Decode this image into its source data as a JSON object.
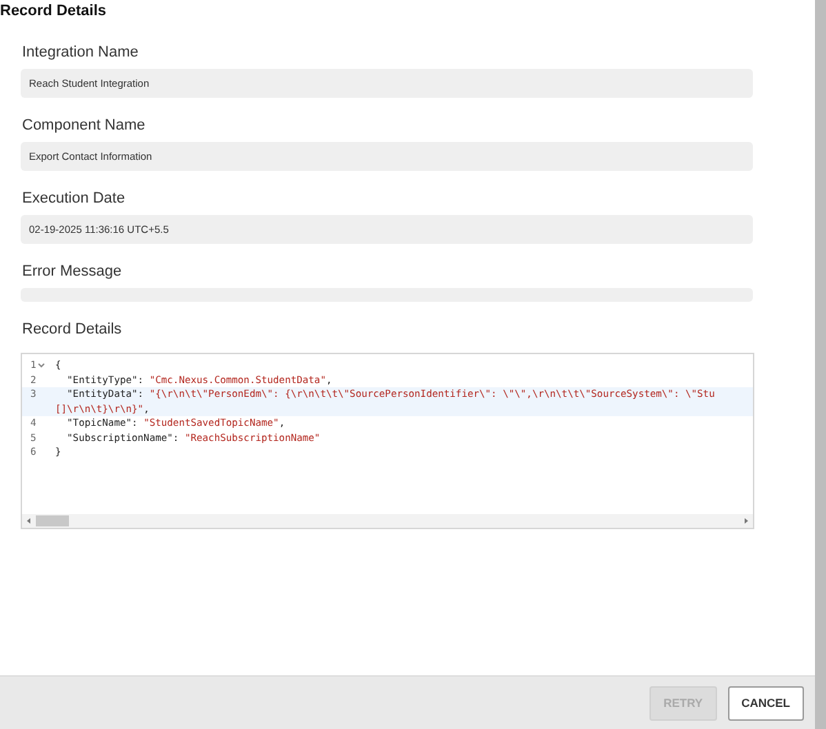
{
  "title": "Record Details",
  "fields": [
    {
      "label": "Integration Name",
      "value": "Reach Student Integration"
    },
    {
      "label": "Component Name",
      "value": "Export Contact Information"
    },
    {
      "label": "Execution Date",
      "value": "02-19-2025 11:36:16 UTC+5.5"
    },
    {
      "label": "Error Message"
    }
  ],
  "editor": {
    "label": "Record Details",
    "lines": [
      {
        "number": "1",
        "foldable": true,
        "active": false,
        "rows": [
          {
            "parts": [
              {
                "kind": "punct",
                "text": "{"
              }
            ]
          }
        ]
      },
      {
        "number": "2",
        "foldable": false,
        "active": false,
        "rows": [
          {
            "parts": [
              {
                "kind": "key",
                "text": "  \"EntityType\""
              },
              {
                "kind": "punct",
                "text": ": "
              },
              {
                "kind": "string",
                "text": "\"Cmc.Nexus.Common.StudentData\""
              },
              {
                "kind": "punct",
                "text": ","
              }
            ]
          }
        ]
      },
      {
        "number": "3",
        "foldable": false,
        "active": true,
        "rows": [
          {
            "parts": [
              {
                "kind": "key",
                "text": "  \"EntityData\""
              },
              {
                "kind": "punct",
                "text": ": "
              },
              {
                "kind": "string",
                "text": "\"{\\r\\n\\t\\\"PersonEdm\\\": {\\r\\n\\t\\t\\\"SourcePersonIdentifier\\\": \\\"\\\",\\r\\n\\t\\t\\\"SourceSystem\\\": \\\"Stu"
              }
            ]
          },
          {
            "parts": [
              {
                "kind": "string",
                "text": "[]\\r\\n\\t}\\r\\n}\""
              },
              {
                "kind": "punct",
                "text": ","
              }
            ]
          }
        ]
      },
      {
        "number": "4",
        "foldable": false,
        "active": false,
        "rows": [
          {
            "parts": [
              {
                "kind": "key",
                "text": "  \"TopicName\""
              },
              {
                "kind": "punct",
                "text": ": "
              },
              {
                "kind": "string",
                "text": "\"StudentSavedTopicName\""
              },
              {
                "kind": "punct",
                "text": ","
              }
            ]
          }
        ]
      },
      {
        "number": "5",
        "foldable": false,
        "active": false,
        "rows": [
          {
            "parts": [
              {
                "kind": "key",
                "text": "  \"SubscriptionName\""
              },
              {
                "kind": "punct",
                "text": ": "
              },
              {
                "kind": "string",
                "text": "\"ReachSubscriptionName\""
              }
            ]
          }
        ]
      },
      {
        "number": "6",
        "foldable": false,
        "active": false,
        "rows": [
          {
            "parts": [
              {
                "kind": "punct",
                "text": "}"
              }
            ]
          }
        ]
      }
    ]
  },
  "buttons": [
    {
      "label": "RETRY",
      "disabled": true
    },
    {
      "label": "CANCEL",
      "disabled": false
    }
  ]
}
